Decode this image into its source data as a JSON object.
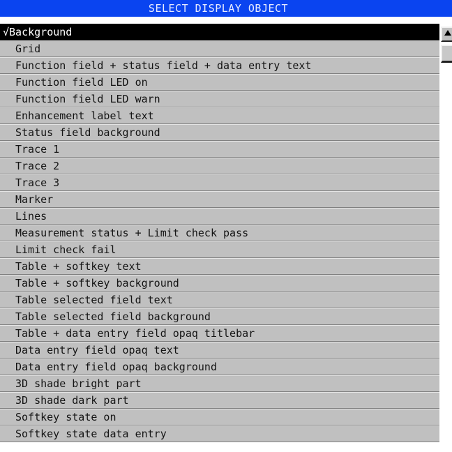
{
  "dialog": {
    "title": "SELECT DISPLAY OBJECT"
  },
  "list": {
    "check_mark": "√",
    "selected_index": 0,
    "items": [
      "Background",
      "Grid",
      "Function field + status field + data entry text",
      "Function field LED on",
      "Function field LED warn",
      "Enhancement label text",
      "Status field background",
      "Trace 1",
      "Trace 2",
      "Trace 3",
      "Marker",
      "Lines",
      "Measurement status + Limit check pass",
      "Limit check fail",
      "Table + softkey text",
      "Table + softkey background",
      "Table selected field text",
      "Table selected field background",
      "Table + data entry field opaq titlebar",
      "Data entry field opaq text",
      "Data entry field opaq background",
      "3D shade bright part",
      "3D shade dark part",
      "Softkey state on",
      "Softkey state data entry"
    ]
  },
  "colors": {
    "titlebar": "#0a44f0",
    "row_background": "#c0c0c0",
    "selected_background": "#000000",
    "selected_text": "#ffffff"
  },
  "icons": {
    "scroll_up": "up-arrow-icon",
    "check": "check-mark-icon"
  }
}
